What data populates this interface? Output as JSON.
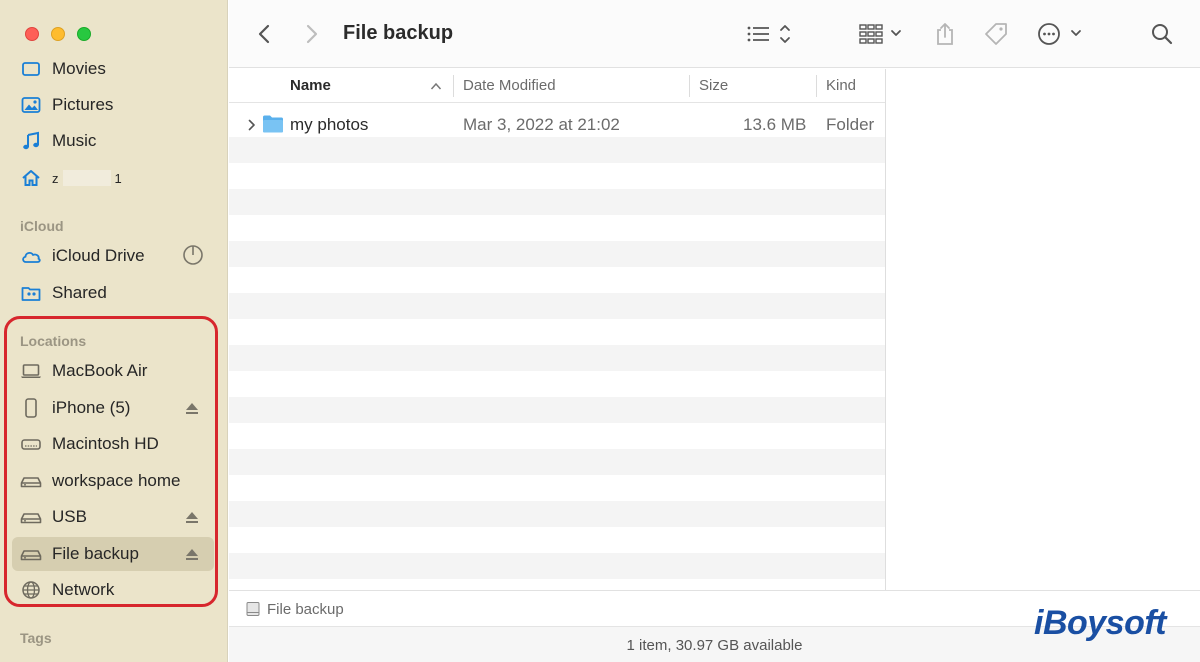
{
  "window": {
    "title": "File backup"
  },
  "sidebar": {
    "favorites": [
      {
        "label": "Movies",
        "icon": "film-icon"
      },
      {
        "label": "Pictures",
        "icon": "photo-icon"
      },
      {
        "label": "Music",
        "icon": "music-note-icon"
      },
      {
        "label": "z",
        "label_end": "1",
        "icon": "home-icon"
      }
    ],
    "icloud_header": "iCloud",
    "icloud": [
      {
        "label": "iCloud Drive",
        "icon": "cloud-icon"
      },
      {
        "label": "Shared",
        "icon": "shared-folder-icon"
      }
    ],
    "locations_header": "Locations",
    "locations": [
      {
        "label": "MacBook Air",
        "icon": "laptop-icon",
        "eject": false
      },
      {
        "label": "iPhone (5)",
        "icon": "iphone-icon",
        "eject": true
      },
      {
        "label": "Macintosh HD",
        "icon": "internal-drive-icon",
        "eject": false
      },
      {
        "label": "workspace home",
        "icon": "external-drive-icon",
        "eject": false
      },
      {
        "label": "USB",
        "icon": "external-drive-icon",
        "eject": true
      },
      {
        "label": "File backup",
        "icon": "external-drive-icon",
        "eject": true,
        "selected": true
      },
      {
        "label": "Network",
        "icon": "globe-icon",
        "eject": false
      }
    ],
    "tags_header": "Tags"
  },
  "table": {
    "columns": {
      "name": "Name",
      "date": "Date Modified",
      "size": "Size",
      "kind": "Kind"
    },
    "rows": [
      {
        "name": "my photos",
        "date": "Mar 3, 2022 at 21:02",
        "size": "13.6 MB",
        "kind": "Folder"
      }
    ]
  },
  "pathbar": {
    "label": "File backup"
  },
  "status": {
    "text": "1 item, 30.97 GB available"
  },
  "watermark": "iBoysoft",
  "colors": {
    "sidebar_bg": "#ebe4ca",
    "highlight": "#d7262d",
    "folder": "#5ab0ec"
  }
}
